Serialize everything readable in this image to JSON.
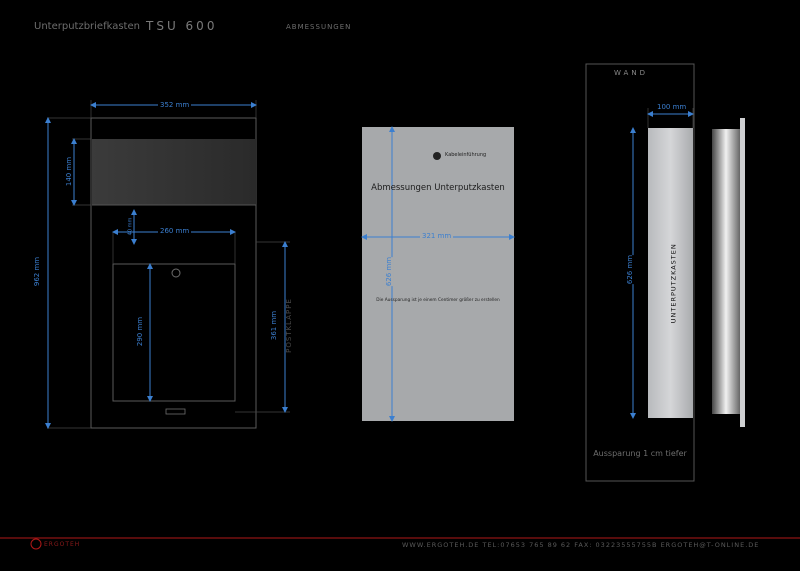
{
  "header": {
    "title": "Unterputzbriefkasten",
    "model": "TSU 600",
    "section": "ABMESSUNGEN"
  },
  "front_view": {
    "dim_width": "352 mm",
    "dim_top_height": "140 mm",
    "dim_total_height": "962 mm",
    "dim_inner_width": "260 mm",
    "dim_small": "40 mm",
    "dim_door_height": "290 mm",
    "dim_slot_height": "361 mm",
    "slot_label": "POSTKLAPPE"
  },
  "cutout_panel": {
    "cable_label": "Kabeleinführung",
    "title": "Abmessungen Unterputzkasten",
    "dim_width": "321 mm",
    "dim_height": "626 mm",
    "note": "Die Aussparung ist je einem Centimer größer zu erstellen"
  },
  "side_view": {
    "wall_label": "WAND",
    "dim_depth": "100 mm",
    "dim_height": "626 mm",
    "box_label": "UNTERPUTZKASTEN",
    "note": "Aussparung 1 cm tiefer"
  },
  "footer": {
    "logo_text": "ERGOTEH",
    "contact": "WWW.ERGOTEH.DE   TEL:07653 765 89 62 FAX: 03223555755B   ERGOTEH@T-ONLINE.DE"
  },
  "colors": {
    "background": "#000000",
    "dimension_blue": "#3b7fd0",
    "panel_gray": "#a7a9ab",
    "footer_line": "#b01818"
  }
}
